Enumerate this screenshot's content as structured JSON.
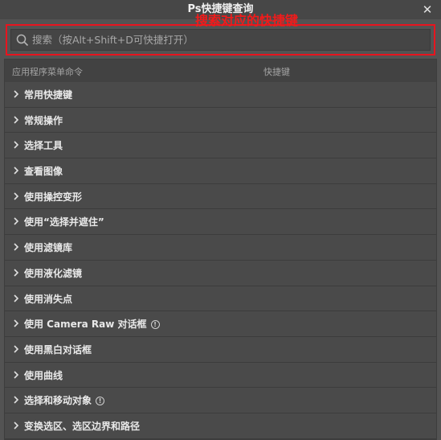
{
  "window": {
    "title": "Ps快捷键查询",
    "close_glyph": "✕"
  },
  "search": {
    "placeholder": "搜索（按Alt+Shift+D可快捷打开）",
    "value": "",
    "icon": "search-icon"
  },
  "annotation": {
    "text": "搜索对应的快捷键",
    "color": "#f01b1b"
  },
  "table": {
    "columns": {
      "command": "应用程序菜单命令",
      "shortcut": "快捷键"
    },
    "rows": [
      {
        "label": "常用快捷键",
        "info": false
      },
      {
        "label": "常规操作",
        "info": false
      },
      {
        "label": "选择工具",
        "info": false
      },
      {
        "label": "查看图像",
        "info": false
      },
      {
        "label": "使用操控变形",
        "info": false
      },
      {
        "label": "使用“选择并遮住”",
        "info": false
      },
      {
        "label": "使用滤镜库",
        "info": false
      },
      {
        "label": "使用液化滤镜",
        "info": false
      },
      {
        "label": "使用消失点",
        "info": false
      },
      {
        "label": "使用 Camera Raw 对话框",
        "info": true
      },
      {
        "label": "使用黑白对话框",
        "info": false
      },
      {
        "label": "使用曲线",
        "info": false
      },
      {
        "label": "选择和移动对象",
        "info": true
      },
      {
        "label": "变换选区、选区边界和路径",
        "info": false
      }
    ]
  },
  "colors": {
    "highlight_border": "#e8141e",
    "background": "#535353"
  }
}
